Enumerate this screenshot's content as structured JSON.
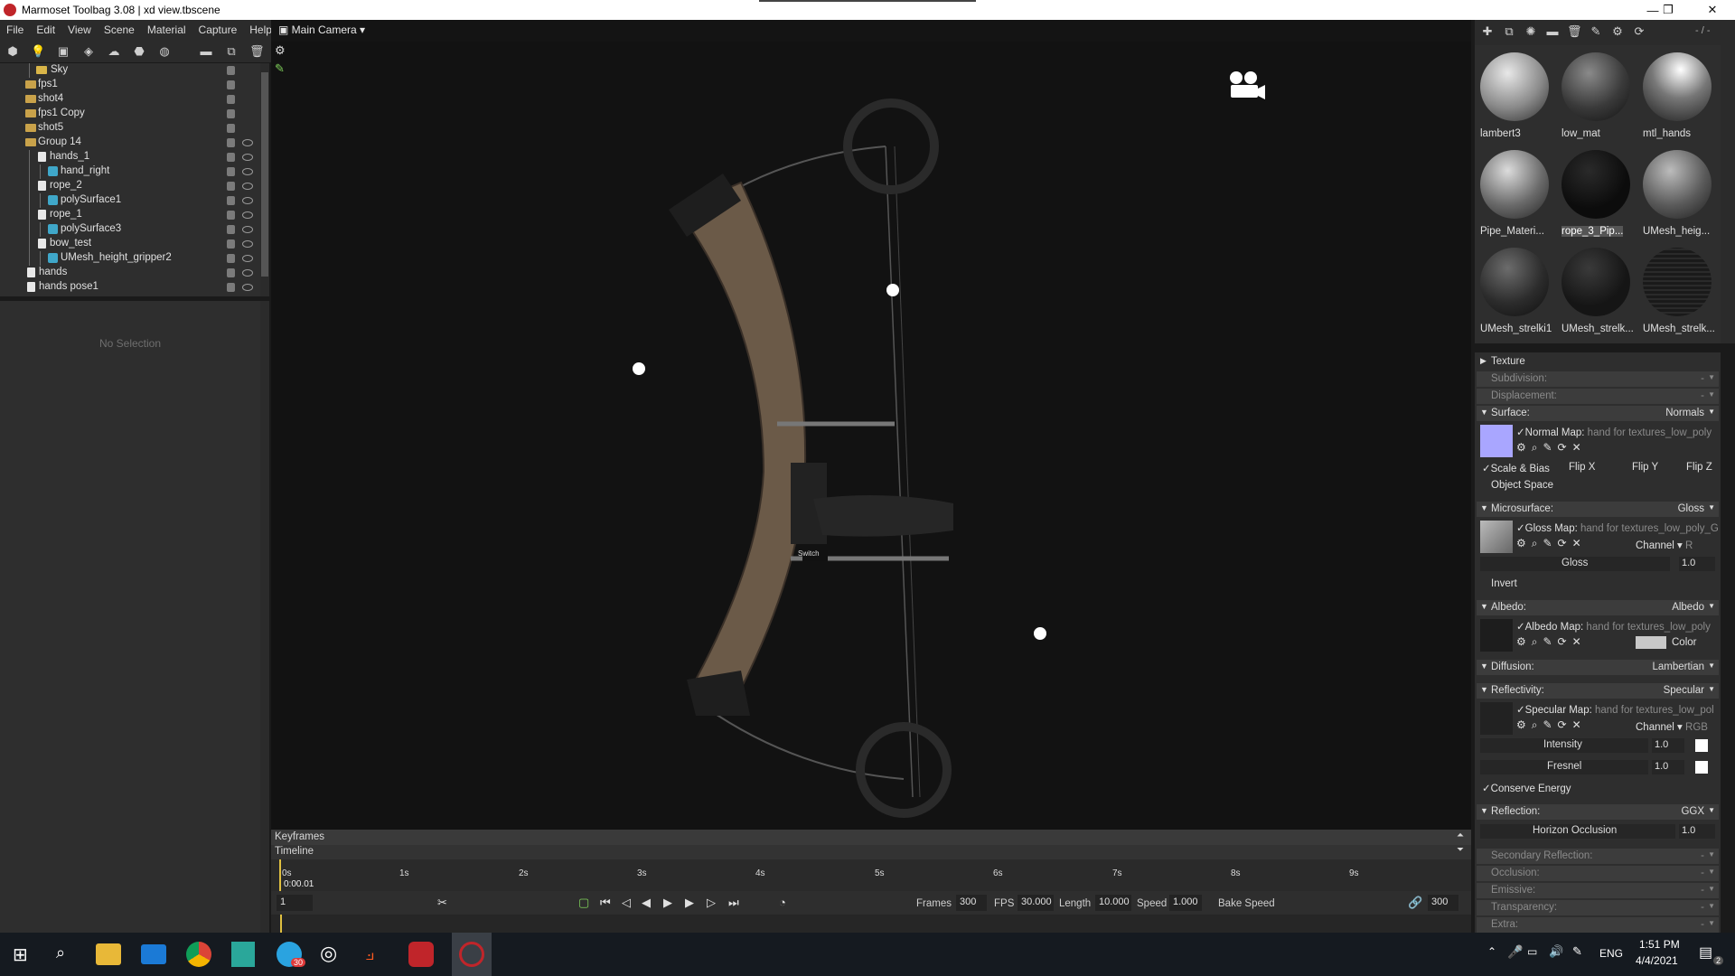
{
  "window": {
    "title": "Marmoset Toolbag 3.08  |  xd view.tbscene",
    "min": "—",
    "max": "❐",
    "close": "✕"
  },
  "menu": [
    "File",
    "Edit",
    "View",
    "Scene",
    "Material",
    "Capture",
    "Help"
  ],
  "outliner": {
    "rows": [
      {
        "label": "Sky",
        "icon": "sky"
      },
      {
        "label": "fps1",
        "icon": "folder"
      },
      {
        "label": "shot4",
        "icon": "folder"
      },
      {
        "label": "fps1 Copy",
        "icon": "folder"
      },
      {
        "label": "shot5",
        "icon": "folder"
      },
      {
        "label": "Group 14",
        "icon": "folder"
      },
      {
        "label": "hands_1",
        "icon": "doc"
      },
      {
        "label": "hand_right",
        "icon": "cube"
      },
      {
        "label": "rope_2",
        "icon": "doc"
      },
      {
        "label": "polySurface1",
        "icon": "cube"
      },
      {
        "label": "rope_1",
        "icon": "doc"
      },
      {
        "label": "polySurface3",
        "icon": "cube"
      },
      {
        "label": "bow_test",
        "icon": "doc"
      },
      {
        "label": "UMesh_height_gripper2",
        "icon": "cube"
      },
      {
        "label": "hands",
        "icon": "doc"
      },
      {
        "label": "hands pose1",
        "icon": "doc"
      }
    ]
  },
  "properties": {
    "empty": "No Selection"
  },
  "viewport": {
    "camera": "Main Camera",
    "switch_label": "Switch"
  },
  "timeline": {
    "keyframes": "Keyframes",
    "timeline": "Timeline",
    "ticks": [
      "0s",
      "1s",
      "2s",
      "3s",
      "4s",
      "5s",
      "6s",
      "7s",
      "8s",
      "9s"
    ],
    "current_time": "0:00.01",
    "frame_field": "1",
    "frames_label": "Frames",
    "frames": "300",
    "fps_label": "FPS",
    "fps": "30.000",
    "length_label": "Length",
    "length": "10.000",
    "speed_label": "Speed",
    "speed": "1.000",
    "bake_speed": "Bake Speed",
    "end_frame": "300"
  },
  "materials": [
    {
      "name": "lambert3",
      "style": "gray"
    },
    {
      "name": "low_mat",
      "style": "dark-metal"
    },
    {
      "name": "mtl_hands",
      "style": "hands"
    },
    {
      "name": "Pipe_Materi...",
      "style": "gray2"
    },
    {
      "name": "rope_3_Pip...",
      "style": "black"
    },
    {
      "name": "UMesh_heig...",
      "style": "gray3"
    },
    {
      "name": "UMesh_strelki1",
      "style": "dark-metal2"
    },
    {
      "name": "UMesh_strelk...",
      "style": "dark"
    },
    {
      "name": "UMesh_strelk...",
      "style": "dark-lines"
    }
  ],
  "material_toolbar_right": "- / -",
  "matprops": {
    "texture": "Texture",
    "subdivision": "Subdivision:",
    "displacement": "Displacement:",
    "dash": "-",
    "surface": "Surface:",
    "surface_val": "Normals",
    "normal_map": "Normal Map:",
    "normal_map_file": "hand for textures_low_poly",
    "scale_bias": "Scale & Bias",
    "flip_x": "Flip X",
    "flip_y": "Flip Y",
    "flip_z": "Flip Z",
    "object_space": "Object Space",
    "microsurface": "Microsurface:",
    "microsurface_val": "Gloss",
    "gloss_map": "Gloss Map:",
    "gloss_map_file": "hand for textures_low_poly_G",
    "channel": "Channel",
    "channel_r": "R",
    "gloss": "Gloss",
    "gloss_val": "1.0",
    "invert": "Invert",
    "albedo": "Albedo:",
    "albedo_val": "Albedo",
    "albedo_map": "Albedo Map:",
    "albedo_map_file": "hand for textures_low_poly",
    "color": "Color",
    "diffusion": "Diffusion:",
    "diffusion_val": "Lambertian",
    "reflectivity": "Reflectivity:",
    "reflectivity_val": "Specular",
    "specular_map": "Specular Map:",
    "specular_map_file": "hand for textures_low_pol",
    "channel_rgb": "RGB",
    "intensity": "Intensity",
    "intensity_val": "1.0",
    "fresnel": "Fresnel",
    "fresnel_val": "1.0",
    "conserve_energy": "Conserve Energy",
    "reflection": "Reflection:",
    "reflection_val": "GGX",
    "horizon_occlusion": "Horizon Occlusion",
    "horizon_val": "1.0",
    "secondary_reflection": "Secondary Reflection:",
    "occlusion": "Occlusion:",
    "emissive": "Emissive:",
    "transparency": "Transparency:",
    "extra": "Extra:"
  },
  "taskbar": {
    "lang": "ENG",
    "time": "1:51 PM",
    "date": "4/4/2021",
    "telegram_badge": "30",
    "notif_badge": "2"
  },
  "colors": {
    "accent": "#3fa7c9",
    "folder": "#c9a24a",
    "panel": "#2e2e2e",
    "viewport": "#121212"
  }
}
